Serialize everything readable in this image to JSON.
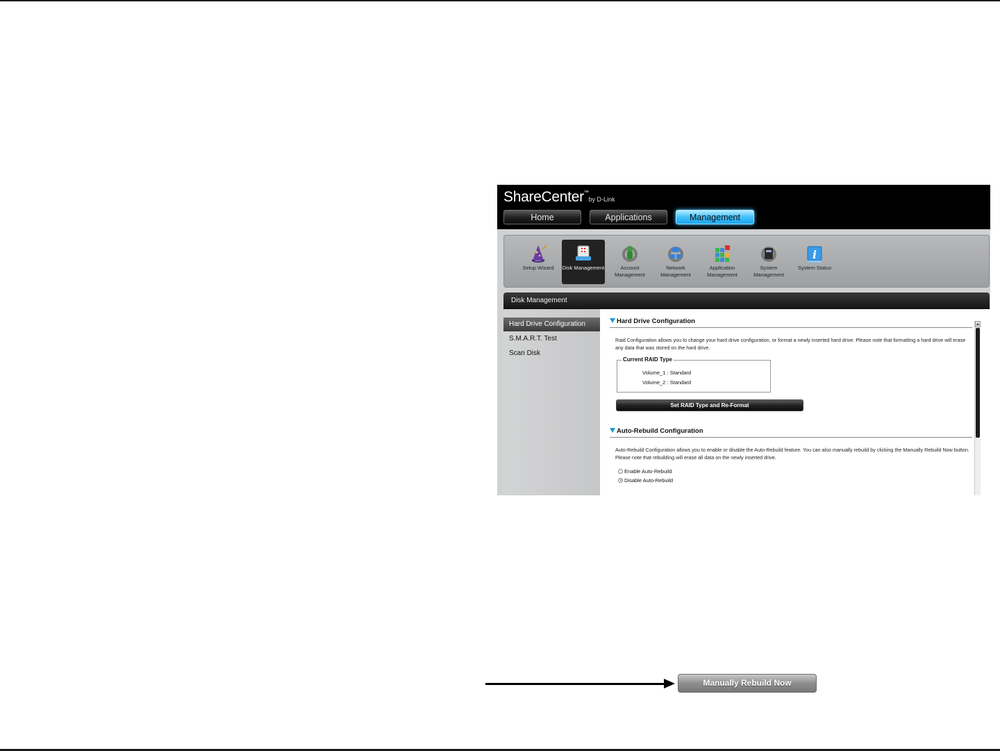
{
  "app": {
    "brand": "ShareCenter",
    "brand_tm": "™",
    "brand_by": "by D-Link"
  },
  "nav_tabs": [
    {
      "label": "Home"
    },
    {
      "label": "Applications"
    },
    {
      "label": "Management"
    }
  ],
  "tools": [
    {
      "label": "Setup Wizard",
      "icon": "wizard-icon"
    },
    {
      "label": "Disk Management",
      "icon": "disk-icon"
    },
    {
      "label": "Account Management",
      "icon": "account-icon"
    },
    {
      "label": "Network Management",
      "icon": "network-icon"
    },
    {
      "label": "Application Management",
      "icon": "application-icon"
    },
    {
      "label": "System Management",
      "icon": "system-icon"
    },
    {
      "label": "System Status",
      "icon": "info-icon"
    }
  ],
  "panel": {
    "title": "Disk Management"
  },
  "sidebar": {
    "items": [
      {
        "label": "Hard Drive Configuration"
      },
      {
        "label": "S.M.A.R.T. Test"
      },
      {
        "label": "Scan Disk"
      }
    ]
  },
  "hdc": {
    "title": "Hard Drive Configuration",
    "description": "Raid Configuration allows you to change your hard drive configuration, or format a newly inserted hard drive. Please note that formatting a hard drive will erase any data that was stored on the hard drive.",
    "raid_legend": "Current RAID Type",
    "volumes": [
      "Volume_1 : Standard",
      "Volume_2 : Standard"
    ],
    "button_label": "Set RAID Type and Re-Format"
  },
  "autorebuild": {
    "title": "Auto-Rebuild Configuration",
    "description": "Auto-Rebuild Configuration allows you to enable or disable the Auto-Rebuild feature. You can also manually rebuild by clicking the Manually Rebuild Now button. Please note that rebuilding will erase all data on the newly inserted drive.",
    "options": [
      {
        "label": "Enable Auto-Rebuild",
        "selected": false
      },
      {
        "label": "Disable Auto-Rebuild",
        "selected": true
      }
    ]
  },
  "callout": {
    "button_label": "Manually Rebuild Now"
  },
  "colors": {
    "active_tab": "#49c4ff",
    "section_triangle": "#1a9ad6"
  }
}
